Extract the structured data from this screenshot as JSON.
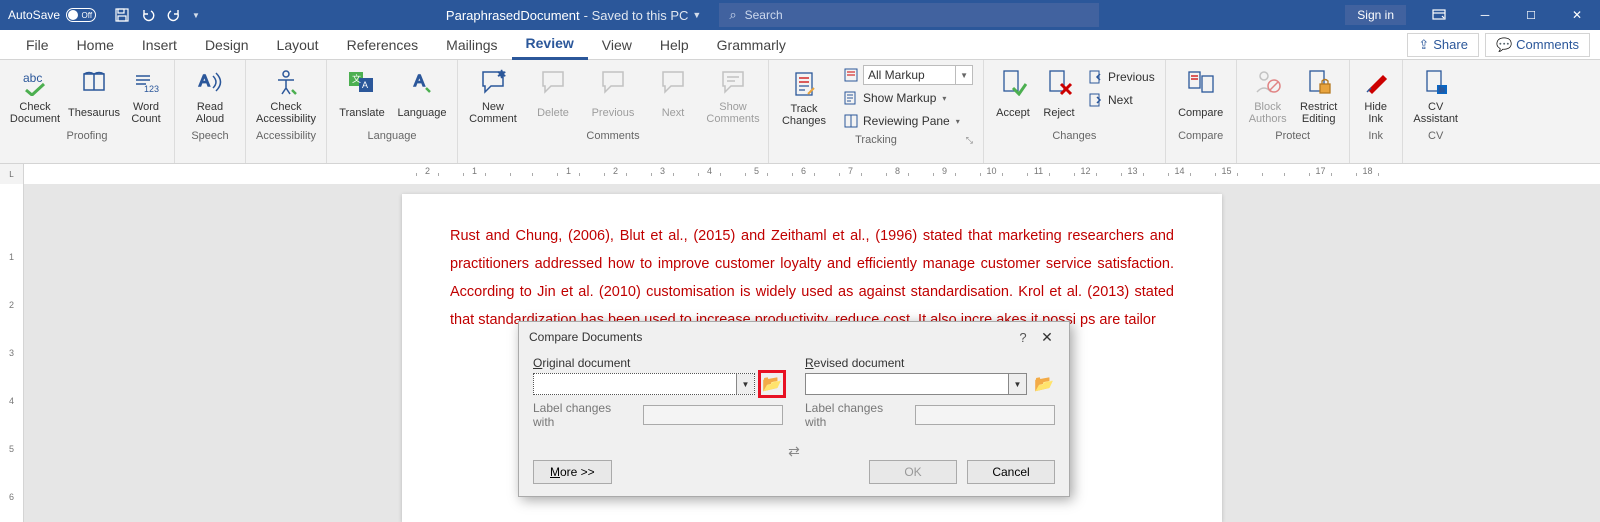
{
  "titlebar": {
    "autosave_label": "AutoSave",
    "autosave_state": "Off",
    "doc_name": "ParaphrasedDocument",
    "doc_status": "Saved to this PC",
    "search_placeholder": "Search",
    "signin": "Sign in"
  },
  "tabs": {
    "items": [
      "File",
      "Home",
      "Insert",
      "Design",
      "Layout",
      "References",
      "Mailings",
      "Review",
      "View",
      "Help",
      "Grammarly"
    ],
    "active": "Review",
    "share": "Share",
    "comments": "Comments"
  },
  "ribbon": {
    "proofing": {
      "label": "Proofing",
      "check_document": "Check\nDocument",
      "thesaurus": "Thesaurus",
      "word_count": "Word\nCount"
    },
    "speech": {
      "label": "Speech",
      "read_aloud": "Read\nAloud"
    },
    "accessibility": {
      "label": "Accessibility",
      "check_accessibility": "Check\nAccessibility"
    },
    "language": {
      "label": "Language",
      "translate": "Translate",
      "language": "Language"
    },
    "comments": {
      "label": "Comments",
      "new_comment": "New\nComment",
      "delete": "Delete",
      "previous": "Previous",
      "next": "Next",
      "show_comments": "Show\nComments"
    },
    "tracking": {
      "label": "Tracking",
      "track_changes": "Track\nChanges",
      "display": "All Markup",
      "show_markup": "Show Markup",
      "reviewing_pane": "Reviewing Pane"
    },
    "changes": {
      "label": "Changes",
      "accept": "Accept",
      "reject": "Reject",
      "previous": "Previous",
      "next": "Next"
    },
    "compare_group": {
      "label": "Compare",
      "compare": "Compare"
    },
    "protect": {
      "label": "Protect",
      "block_authors": "Block\nAuthors",
      "restrict_editing": "Restrict\nEditing"
    },
    "ink": {
      "label": "Ink",
      "hide_ink": "Hide\nInk"
    },
    "cv": {
      "label": "CV",
      "cv_assistant": "CV\nAssistant"
    }
  },
  "ruler": {
    "h": [
      "2",
      "1",
      "",
      "1",
      "2",
      "3",
      "4",
      "5",
      "6",
      "7",
      "8",
      "9",
      "10",
      "11",
      "12",
      "13",
      "14",
      "15",
      "",
      "17",
      "18"
    ],
    "v": [
      "",
      "1",
      "2",
      "3",
      "4",
      "5",
      "6"
    ]
  },
  "document": {
    "body": "Rust and Chung, (2006), Blut et al., (2015) and Zeithaml et al., (1996) stated that marketing researchers and practitioners addressed how to improve customer loyalty and efficiently manage customer service satisfaction. According to Jin et al. (2010) customisation is widely used as against standardisation. Krol et al. (2013) stated that standardization has been used to increase productivity, reduce cost. It also incre                                                                                                                                                                  akes it possi                                                                                                                                                                              ps are tailor"
  },
  "dialog": {
    "title": "Compare Documents",
    "original_label": "Original document",
    "revised_label": "Revised document",
    "label_changes": "Label changes with",
    "more": "More >>",
    "ok": "OK",
    "cancel": "Cancel"
  }
}
